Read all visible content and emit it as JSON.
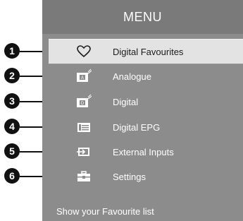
{
  "menu": {
    "title": "MENU",
    "items": [
      {
        "number": "1",
        "label": "Digital Favourites",
        "icon": "heart-icon",
        "selected": true
      },
      {
        "number": "2",
        "label": "Analogue",
        "icon": "analogue-tv-icon",
        "selected": false
      },
      {
        "number": "3",
        "label": "Digital",
        "icon": "digital-tv-icon",
        "selected": false
      },
      {
        "number": "4",
        "label": "Digital EPG",
        "icon": "epg-guide-icon",
        "selected": false
      },
      {
        "number": "5",
        "label": "External Inputs",
        "icon": "external-input-icon",
        "selected": false
      },
      {
        "number": "6",
        "label": "Settings",
        "icon": "settings-toolbox-icon",
        "selected": false
      }
    ],
    "footer_text": "Show your Favourite list"
  },
  "colors": {
    "panel": "#8c8c8c",
    "header": "#7a7a7a",
    "selected": "#e3e3e3",
    "callout": "#111111"
  }
}
